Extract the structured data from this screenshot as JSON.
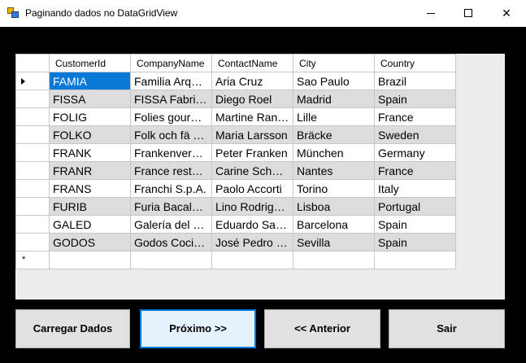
{
  "window": {
    "title": "Paginando dados no DataGridView",
    "minimize_glyph": "",
    "maximize_glyph": "",
    "close_glyph": "✕"
  },
  "grid": {
    "columns": [
      "CustomerId",
      "CompanyName",
      "ContactName",
      "City",
      "Country"
    ],
    "rows": [
      [
        "FAMIA",
        "Familia Arquibaldo",
        "Aria Cruz",
        "Sao Paulo",
        "Brazil"
      ],
      [
        "FISSA",
        "FISSA Fabrica Inter.",
        "Diego Roel",
        "Madrid",
        "Spain"
      ],
      [
        "FOLIG",
        "Folies gourmandes",
        "Martine Rancé",
        "Lille",
        "France"
      ],
      [
        "FOLKO",
        "Folk och fä HB",
        "Maria Larsson",
        "Bräcke",
        "Sweden"
      ],
      [
        "FRANK",
        "Frankenversand",
        "Peter Franken",
        "München",
        "Germany"
      ],
      [
        "FRANR",
        "France restauration",
        "Carine Schmitt",
        "Nantes",
        "France"
      ],
      [
        "FRANS",
        "Franchi S.p.A.",
        "Paolo Accorti",
        "Torino",
        "Italy"
      ],
      [
        "FURIB",
        "Furia Bacalhau e Frutos do Mar",
        "Lino Rodriguez",
        "Lisboa",
        "Portugal"
      ],
      [
        "GALED",
        "Galería del gastrónomo",
        "Eduardo Saavedra",
        "Barcelona",
        "Spain"
      ],
      [
        "GODOS",
        "Godos Cocina Típica",
        "José Pedro Freyre",
        "Sevilla",
        "Spain"
      ]
    ],
    "new_row_marker": "*",
    "selected_row": 0,
    "selected_col": 0
  },
  "buttons": {
    "load": "Carregar Dados",
    "next": "Próximo  >>",
    "prev": "<< Anterior",
    "exit": "Sair"
  },
  "colors": {
    "selection": "#0a78d7",
    "alt_row": "#dcdcdc",
    "focus_border": "#0078d7"
  }
}
